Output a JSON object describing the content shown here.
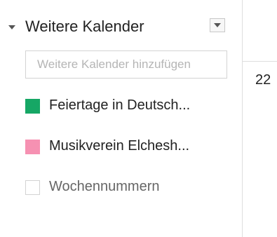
{
  "section": {
    "title": "Weitere Kalender",
    "expand_icon": "chevron-down-icon",
    "menu_icon": "dropdown-menu-icon"
  },
  "add_calendar": {
    "placeholder": "Weitere Kalender hinzufügen"
  },
  "calendars": [
    {
      "label": "Feiertage in Deutsch...",
      "color": "#16a765",
      "checked": true
    },
    {
      "label": "Musikverein Elchesh...",
      "color": "#f691b2",
      "checked": true
    },
    {
      "label": "Wochennummern",
      "color": "#ffffff",
      "checked": false
    }
  ],
  "grid": {
    "day_number": "22"
  }
}
